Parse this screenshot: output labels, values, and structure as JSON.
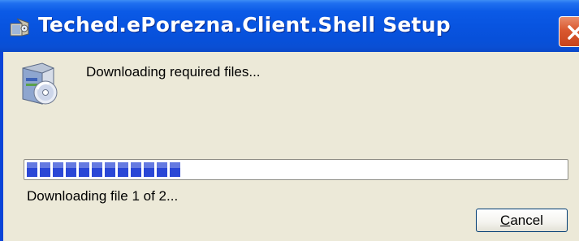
{
  "window": {
    "title": "Teched.ePorezna.Client.Shell Setup",
    "title_icon": "setup-package-icon",
    "close_icon": "close-icon",
    "accent_color": "#0a55e0"
  },
  "dialog": {
    "icon": "setup-disc-icon",
    "message": "Downloading required files...",
    "status": "Downloading file 1 of 2...",
    "progress_percent": 29
  },
  "buttons": {
    "cancel_mnemonic": "C",
    "cancel_rest": "ancel"
  }
}
